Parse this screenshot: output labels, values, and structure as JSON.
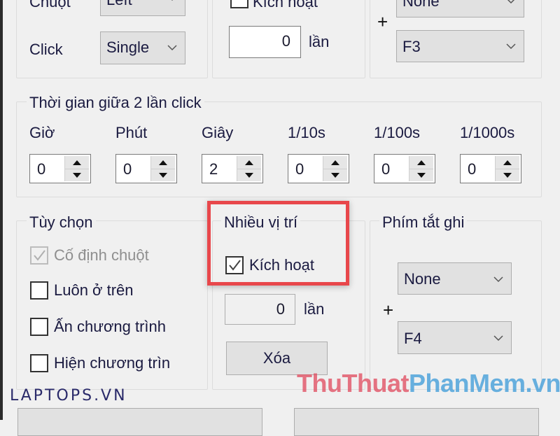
{
  "top_section": {
    "mouse": {
      "mouse_label": "Chuột",
      "mouse_value": "Left",
      "click_label": "Click",
      "click_value": "Single"
    },
    "repeat": {
      "activate_label": "Kích hoạt",
      "activate_checked": false,
      "count_value": "0",
      "count_unit": "lần"
    },
    "hotkey": {
      "modifier_value": "None",
      "plus": "+",
      "key_value": "F3"
    }
  },
  "interval": {
    "title": "Thời gian giữa 2 lần click",
    "fields": [
      {
        "label": "Giờ",
        "value": "0"
      },
      {
        "label": "Phút",
        "value": "0"
      },
      {
        "label": "Giây",
        "value": "2"
      },
      {
        "label": "1/10s",
        "value": "0"
      },
      {
        "label": "1/100s",
        "value": "0"
      },
      {
        "label": "1/1000s",
        "value": "0"
      }
    ]
  },
  "options": {
    "title": "Tùy chọn",
    "items": [
      {
        "label": "Cố định chuột",
        "checked": true,
        "disabled": true
      },
      {
        "label": "Luôn ở trên",
        "checked": false,
        "disabled": false
      },
      {
        "label": "Ấn chương trình",
        "checked": false,
        "disabled": false
      },
      {
        "label": "Hiện chương trìn",
        "checked": false,
        "disabled": false
      }
    ]
  },
  "multi_position": {
    "title": "Nhiều vị trí",
    "activate_label": "Kích hoạt",
    "activate_checked": true,
    "count_value": "0",
    "count_unit": "lần",
    "clear_button": "Xóa"
  },
  "record_hotkey": {
    "title": "Phím tắt ghi",
    "modifier_value": "None",
    "plus": "+",
    "key_value": "F4"
  },
  "watermarks": {
    "laptop": "LAPTOPS.VN",
    "site_part1": "ThuThuat",
    "site_part2": "PhanMem.vn",
    "site_color1": "#e0485c",
    "site_color2": "#3a9ad9"
  },
  "colors": {
    "highlight": "#e8474b"
  }
}
